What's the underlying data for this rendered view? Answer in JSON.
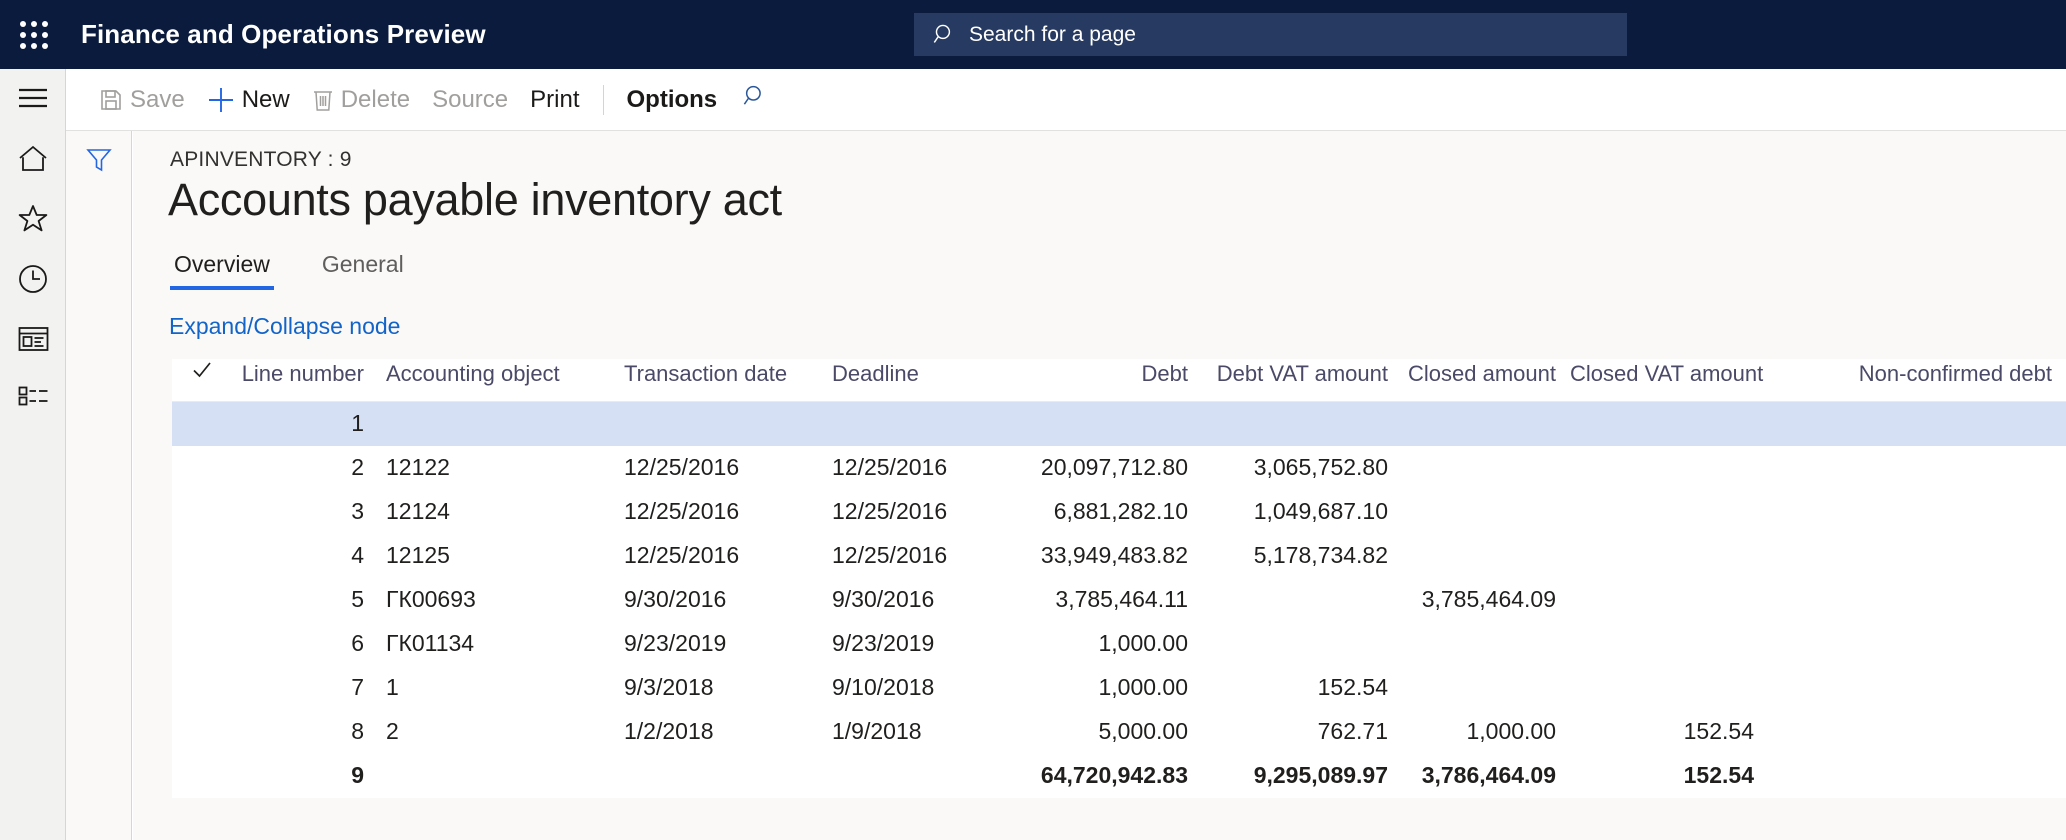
{
  "topbar": {
    "waffle_label": "app-launcher",
    "app_title": "Finance and Operations Preview",
    "search": {
      "placeholder": "Search for a page",
      "value": "",
      "icon": "search-icon"
    },
    "background_color": "#0b1b3d",
    "search_background_color": "#273b62"
  },
  "left_rail": {
    "items": [
      {
        "name": "navigation-menu",
        "icon": "hamburger-icon"
      },
      {
        "name": "home",
        "icon": "home-icon"
      },
      {
        "name": "favorites",
        "icon": "star-icon"
      },
      {
        "name": "recent",
        "icon": "clock-icon"
      },
      {
        "name": "workspaces",
        "icon": "workspace-icon"
      },
      {
        "name": "modules",
        "icon": "list-icon"
      }
    ]
  },
  "command_bar": {
    "items": [
      {
        "label": "Save",
        "icon": "save-icon",
        "disabled": true
      },
      {
        "label": "New",
        "icon": "plus-icon",
        "disabled": false
      },
      {
        "label": "Delete",
        "icon": "trash-icon",
        "disabled": true
      },
      {
        "label": "Source",
        "icon": "",
        "disabled": true
      },
      {
        "label": "Print",
        "icon": "",
        "disabled": false
      }
    ],
    "options_label": "Options",
    "search_icon": "search-icon"
  },
  "filter_strip": {
    "icon": "filter-icon"
  },
  "page": {
    "caption": "APINVENTORY : 9",
    "title": "Accounts payable inventory act",
    "tabs": [
      {
        "label": "Overview",
        "active": true
      },
      {
        "label": "General",
        "active": false
      }
    ],
    "expand_collapse_label": "Expand/Collapse node",
    "accent_color": "#2266e3",
    "link_color": "#1264c8",
    "selected_row_color": "#d5e0f5"
  },
  "grid": {
    "select_all_icon": "checkmark-icon",
    "columns": [
      "Line number",
      "Accounting object",
      "Transaction date",
      "Deadline",
      "Debt",
      "Debt VAT amount",
      "Closed amount",
      "Closed VAT amount",
      "Non-confirmed debt"
    ],
    "rows": [
      {
        "line_number": "1",
        "accounting_object": "",
        "transaction_date": "",
        "deadline": "",
        "debt": "",
        "debt_vat_amount": "",
        "closed_amount": "",
        "closed_vat_amount": "",
        "non_confirmed_debt": "",
        "selected": true,
        "total": false
      },
      {
        "line_number": "2",
        "accounting_object": "12122",
        "transaction_date": "12/25/2016",
        "deadline": "12/25/2016",
        "debt": "20,097,712.80",
        "debt_vat_amount": "3,065,752.80",
        "closed_amount": "",
        "closed_vat_amount": "",
        "non_confirmed_debt": "",
        "selected": false,
        "total": false
      },
      {
        "line_number": "3",
        "accounting_object": "12124",
        "transaction_date": "12/25/2016",
        "deadline": "12/25/2016",
        "debt": "6,881,282.10",
        "debt_vat_amount": "1,049,687.10",
        "closed_amount": "",
        "closed_vat_amount": "",
        "non_confirmed_debt": "",
        "selected": false,
        "total": false
      },
      {
        "line_number": "4",
        "accounting_object": "12125",
        "transaction_date": "12/25/2016",
        "deadline": "12/25/2016",
        "debt": "33,949,483.82",
        "debt_vat_amount": "5,178,734.82",
        "closed_amount": "",
        "closed_vat_amount": "",
        "non_confirmed_debt": "",
        "selected": false,
        "total": false
      },
      {
        "line_number": "5",
        "accounting_object": "ГК00693",
        "transaction_date": "9/30/2016",
        "deadline": "9/30/2016",
        "debt": "3,785,464.11",
        "debt_vat_amount": "",
        "closed_amount": "3,785,464.09",
        "closed_vat_amount": "",
        "non_confirmed_debt": "",
        "selected": false,
        "total": false
      },
      {
        "line_number": "6",
        "accounting_object": "ГК01134",
        "transaction_date": "9/23/2019",
        "deadline": "9/23/2019",
        "debt": "1,000.00",
        "debt_vat_amount": "",
        "closed_amount": "",
        "closed_vat_amount": "",
        "non_confirmed_debt": "",
        "selected": false,
        "total": false
      },
      {
        "line_number": "7",
        "accounting_object": "1",
        "transaction_date": "9/3/2018",
        "deadline": "9/10/2018",
        "debt": "1,000.00",
        "debt_vat_amount": "152.54",
        "closed_amount": "",
        "closed_vat_amount": "",
        "non_confirmed_debt": "",
        "selected": false,
        "total": false
      },
      {
        "line_number": "8",
        "accounting_object": "2",
        "transaction_date": "1/2/2018",
        "deadline": "1/9/2018",
        "debt": "5,000.00",
        "debt_vat_amount": "762.71",
        "closed_amount": "1,000.00",
        "closed_vat_amount": "152.54",
        "non_confirmed_debt": "",
        "selected": false,
        "total": false
      },
      {
        "line_number": "9",
        "accounting_object": "",
        "transaction_date": "",
        "deadline": "",
        "debt": "64,720,942.83",
        "debt_vat_amount": "9,295,089.97",
        "closed_amount": "3,786,464.09",
        "closed_vat_amount": "152.54",
        "non_confirmed_debt": "",
        "selected": false,
        "total": true
      }
    ]
  }
}
